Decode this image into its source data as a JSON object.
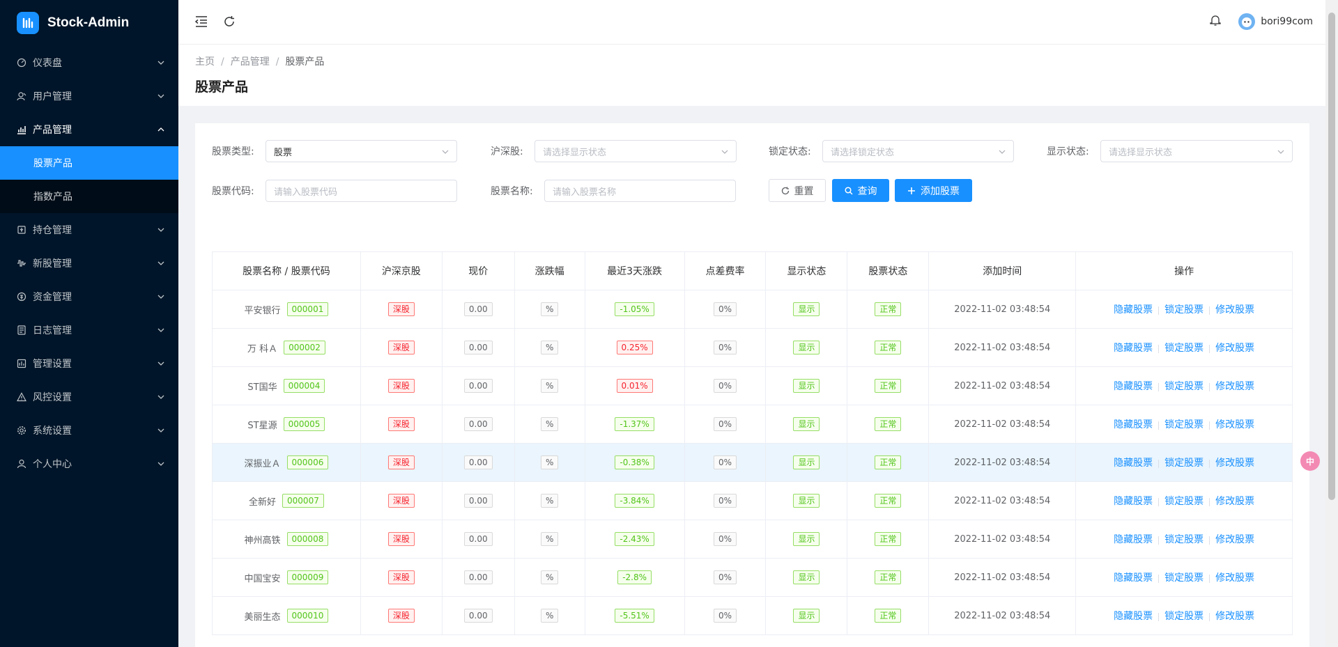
{
  "app": {
    "title": "Stock-Admin"
  },
  "sidebar": {
    "items": [
      {
        "label": "仪表盘",
        "icon": "dashboard-icon"
      },
      {
        "label": "用户管理",
        "icon": "user-manage-icon"
      },
      {
        "label": "产品管理",
        "icon": "chart-icon",
        "open": true
      },
      {
        "label": "持仓管理",
        "icon": "position-icon"
      },
      {
        "label": "新股管理",
        "icon": "ipo-icon"
      },
      {
        "label": "资金管理",
        "icon": "money-icon"
      },
      {
        "label": "日志管理",
        "icon": "log-icon"
      },
      {
        "label": "管理设置",
        "icon": "admin-settings-icon"
      },
      {
        "label": "风控设置",
        "icon": "warning-icon"
      },
      {
        "label": "系统设置",
        "icon": "gear-icon"
      },
      {
        "label": "个人中心",
        "icon": "user-icon"
      }
    ],
    "subitems": [
      {
        "label": "股票产品",
        "active": true
      },
      {
        "label": "指数产品",
        "active": false
      }
    ]
  },
  "header": {
    "username": "bori99com"
  },
  "breadcrumb": {
    "home": "主页",
    "parent": "产品管理",
    "current": "股票产品"
  },
  "page": {
    "title": "股票产品"
  },
  "filters": {
    "type_label": "股票类型:",
    "type_value": "股票",
    "hs_label": "沪深股:",
    "hs_placeholder": "请选择显示状态",
    "lock_label": "锁定状态:",
    "lock_placeholder": "请选择锁定状态",
    "show_label": "显示状态:",
    "show_placeholder": "请选择显示状态",
    "code_label": "股票代码:",
    "code_placeholder": "请输入股票代码",
    "name_label": "股票名称:",
    "name_placeholder": "请输入股票名称",
    "reset": "重置",
    "query": "查询",
    "add": "添加股票"
  },
  "table": {
    "headers": [
      "股票名称 / 股票代码",
      "沪深京股",
      "现价",
      "涨跌幅",
      "最近3天涨跌",
      "点差费率",
      "显示状态",
      "股票状态",
      "添加时间",
      "操作"
    ],
    "ops": [
      "隐藏股票",
      "锁定股票",
      "修改股票"
    ],
    "rows": [
      {
        "name": "平安银行",
        "code": "000001",
        "market": "深股",
        "price": "0.00",
        "chg": "%",
        "chg3": "-1.05%",
        "chg3_up": false,
        "fee": "0%",
        "display": "显示",
        "status": "正常",
        "time": "2022-11-02 03:48:54"
      },
      {
        "name": "万 科Ａ",
        "code": "000002",
        "market": "深股",
        "price": "0.00",
        "chg": "%",
        "chg3": "0.25%",
        "chg3_up": true,
        "fee": "0%",
        "display": "显示",
        "status": "正常",
        "time": "2022-11-02 03:48:54"
      },
      {
        "name": "ST国华",
        "code": "000004",
        "market": "深股",
        "price": "0.00",
        "chg": "%",
        "chg3": "0.01%",
        "chg3_up": true,
        "fee": "0%",
        "display": "显示",
        "status": "正常",
        "time": "2022-11-02 03:48:54"
      },
      {
        "name": "ST星源",
        "code": "000005",
        "market": "深股",
        "price": "0.00",
        "chg": "%",
        "chg3": "-1.37%",
        "chg3_up": false,
        "fee": "0%",
        "display": "显示",
        "status": "正常",
        "time": "2022-11-02 03:48:54"
      },
      {
        "name": "深振业Ａ",
        "code": "000006",
        "market": "深股",
        "price": "0.00",
        "chg": "%",
        "chg3": "-0.38%",
        "chg3_up": false,
        "fee": "0%",
        "display": "显示",
        "status": "正常",
        "time": "2022-11-02 03:48:54",
        "highlight": true
      },
      {
        "name": "全新好",
        "code": "000007",
        "market": "深股",
        "price": "0.00",
        "chg": "%",
        "chg3": "-3.84%",
        "chg3_up": false,
        "fee": "0%",
        "display": "显示",
        "status": "正常",
        "time": "2022-11-02 03:48:54"
      },
      {
        "name": "神州高铁",
        "code": "000008",
        "market": "深股",
        "price": "0.00",
        "chg": "%",
        "chg3": "-2.43%",
        "chg3_up": false,
        "fee": "0%",
        "display": "显示",
        "status": "正常",
        "time": "2022-11-02 03:48:54"
      },
      {
        "name": "中国宝安",
        "code": "000009",
        "market": "深股",
        "price": "0.00",
        "chg": "%",
        "chg3": "-2.8%",
        "chg3_up": false,
        "fee": "0%",
        "display": "显示",
        "status": "正常",
        "time": "2022-11-02 03:48:54"
      },
      {
        "name": "美丽生态",
        "code": "000010",
        "market": "深股",
        "price": "0.00",
        "chg": "%",
        "chg3": "-5.51%",
        "chg3_up": false,
        "fee": "0%",
        "display": "显示",
        "status": "正常",
        "time": "2022-11-02 03:48:54"
      }
    ]
  },
  "float_button": {
    "label": "中"
  },
  "colors": {
    "primary": "#1890ff",
    "sidebar": "#001529",
    "up": "#f5222d",
    "down": "#52c41a"
  }
}
